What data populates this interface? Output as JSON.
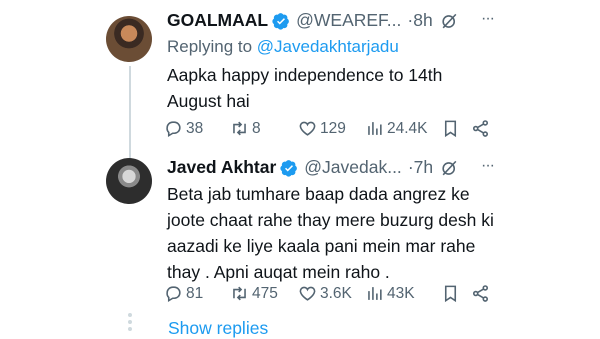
{
  "colors": {
    "accent": "#1d9bf0",
    "muted": "#536471",
    "text": "#0f1419"
  },
  "tweets": [
    {
      "name": "GOALMAAL",
      "handle": "@WEAREF...",
      "time": "·8h",
      "replying_prefix": "Replying to",
      "replying_to": "@Javedakhtarjadu",
      "text": "Aapka happy independence to 14th August hai",
      "replies": "38",
      "retweets": "8",
      "likes": "129",
      "views": "24.4K"
    },
    {
      "name": "Javed Akhtar",
      "handle": "@Javedak...",
      "time": "·7h",
      "text": "Beta jab tumhare baap dada angrez ke joote chaat rahe thay mere buzurg desh ki aazadi ke liye kaala pani mein mar rahe thay . Apni auqat mein raho .",
      "replies": "81",
      "retweets": "475",
      "likes": "3.6K",
      "views": "43K"
    }
  ],
  "show_replies": "Show replies"
}
